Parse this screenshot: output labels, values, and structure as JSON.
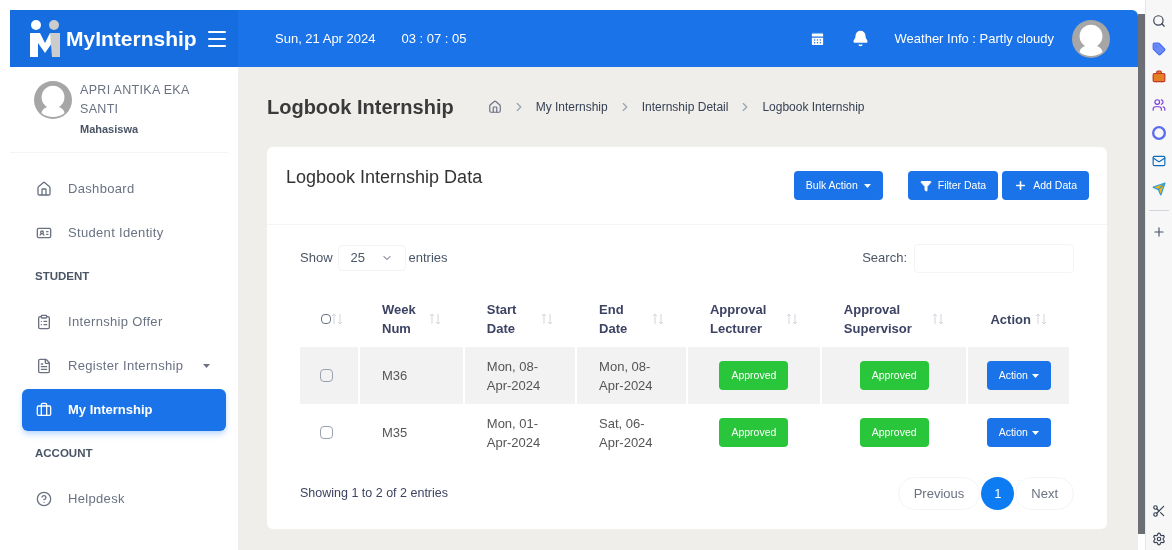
{
  "header": {
    "brand": "MyInternship",
    "date": "Sun, 21 Apr 2024",
    "time": "03 : 07 : 05",
    "weather": "Weather Info : Partly cloudy"
  },
  "profile": {
    "name": "APRI ANTIKA EKA SANTI",
    "role": "Mahasiswa"
  },
  "nav": [
    {
      "kind": "item",
      "label": "Dashboard",
      "selected": false
    },
    {
      "kind": "item",
      "label": "Student Identity",
      "selected": false
    },
    {
      "kind": "section",
      "label": "STUDENT"
    },
    {
      "kind": "item",
      "label": "Internship Offer",
      "selected": false
    },
    {
      "kind": "item",
      "label": "Register Internship",
      "selected": false,
      "submenu": true
    },
    {
      "kind": "item",
      "label": "My Internship",
      "selected": true
    },
    {
      "kind": "section",
      "label": "ACCOUNT"
    },
    {
      "kind": "item",
      "label": "Helpdesk",
      "selected": false
    }
  ],
  "page": {
    "title": "Logbook Internship",
    "breadcrumb": [
      "My Internship",
      "Internship Detail",
      "Logbook Internship"
    ]
  },
  "card": {
    "title": "Logbook Internship Data",
    "buttons": [
      {
        "kind": "dropdown",
        "label": "Bulk Action"
      },
      {
        "kind": "filter",
        "label": "Filter Data"
      },
      {
        "kind": "add",
        "label": "Add Data"
      }
    ],
    "select_all_checked": false,
    "show_label": "Show",
    "page_size": "25",
    "entries_label": "entries",
    "search_label": "Search:",
    "columns": [
      "Week Num",
      "Start Date",
      "End Date",
      "Approval Lecturer",
      "Approval Supervisor",
      "Action"
    ],
    "rows": [
      {
        "checked": false,
        "week": "M36",
        "start": "Mon, 08-Apr-2024",
        "end": "Mon, 08-Apr-2024",
        "lecturer": "Approved",
        "supervisor": "Approved",
        "action": "Action"
      },
      {
        "checked": false,
        "week": "M35",
        "start": "Mon, 01-Apr-2024",
        "end": "Sat, 06-Apr-2024",
        "lecturer": "Approved",
        "supervisor": "Approved",
        "action": "Action"
      }
    ],
    "info": "Showing 1 to 2 of 2 entries",
    "pagination": [
      {
        "label": "Previous",
        "selected": false
      },
      {
        "label": "1",
        "selected": true
      },
      {
        "label": "Next",
        "selected": false
      }
    ]
  }
}
